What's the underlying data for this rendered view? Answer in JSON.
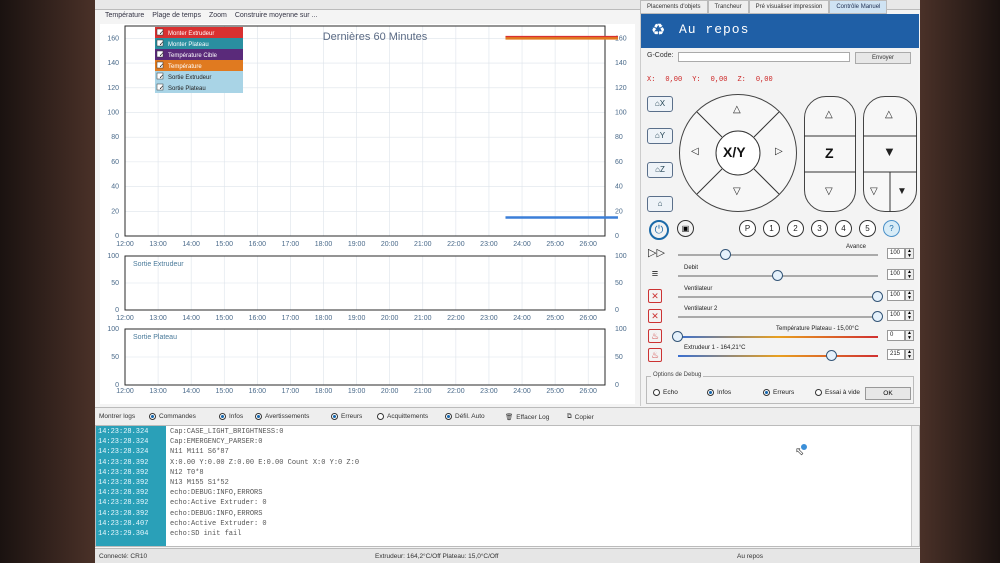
{
  "top_tabs": [
    "Placements d'objets",
    "Trancheur",
    "Pré visualiser impression",
    "Contrôle Manuel"
  ],
  "menu": [
    "Température",
    "Plage de temps",
    "Zoom",
    "Construire moyenne sur ..."
  ],
  "chart_data": [
    {
      "type": "line",
      "title": "Dernières 60 Minutes",
      "x_ticks": [
        "12:00",
        "13:00",
        "14:00",
        "15:00",
        "16:00",
        "17:00",
        "18:00",
        "19:00",
        "20:00",
        "21:00",
        "22:00",
        "23:00",
        "24:00",
        "25:00",
        "26:00"
      ],
      "y_ticks_left": [
        0,
        20,
        40,
        60,
        80,
        100,
        120,
        140,
        160
      ],
      "y_ticks_right": [
        0,
        20,
        40,
        60,
        80,
        100,
        120,
        140,
        160
      ],
      "ylim": [
        0,
        170
      ],
      "legend": [
        {
          "name": "Monter Extrudeur",
          "color": "#d93030",
          "checked": true
        },
        {
          "name": "Monter Plateau",
          "color": "#2a8fa0",
          "checked": true
        },
        {
          "name": "Température Cible",
          "color": "#5a2a7a",
          "checked": true
        },
        {
          "name": "Température",
          "color": "#e07a20",
          "checked": true
        },
        {
          "name": "Sortie Extrudeur",
          "color": "#6fb2d0",
          "checked": true
        },
        {
          "name": "Sortie Plateau",
          "color": "#6fb2d0",
          "checked": true
        }
      ],
      "series": [
        {
          "name": "Monter Extrudeur",
          "color": "#d93030",
          "x": [
            23.5,
            26.9
          ],
          "y": [
            161,
            161
          ]
        },
        {
          "name": "Température",
          "color": "#e07a20",
          "x": [
            23.5,
            26.9
          ],
          "y": [
            160,
            160
          ]
        },
        {
          "name": "Monter Plateau",
          "color": "#3b7fd8",
          "x": [
            23.5,
            26.9
          ],
          "y": [
            15,
            15
          ]
        }
      ]
    },
    {
      "type": "line",
      "title": "Sortie Extrudeur",
      "x_ticks": [
        "12:00",
        "13:00",
        "14:00",
        "15:00",
        "16:00",
        "17:00",
        "18:00",
        "19:00",
        "20:00",
        "21:00",
        "22:00",
        "23:00",
        "24:00",
        "25:00",
        "26:00"
      ],
      "y_ticks_left": [
        0,
        50,
        100
      ],
      "y_ticks_right": [
        0,
        50,
        100
      ],
      "ylim": [
        0,
        100
      ],
      "series": []
    },
    {
      "type": "line",
      "title": "Sortie Plateau",
      "x_ticks": [
        "12:00",
        "13:00",
        "14:00",
        "15:00",
        "16:00",
        "17:00",
        "18:00",
        "19:00",
        "20:00",
        "21:00",
        "22:00",
        "23:00",
        "24:00",
        "25:00",
        "26:00"
      ],
      "y_ticks_left": [
        0,
        50,
        100
      ],
      "y_ticks_right": [
        0,
        50,
        100
      ],
      "ylim": [
        0,
        100
      ],
      "series": []
    }
  ],
  "control": {
    "status": "Au repos",
    "gcode_label": "G-Code:",
    "send_label": "Envoyer",
    "coords": {
      "x_label": "X:",
      "x": "0,00",
      "y_label": "Y:",
      "y": "0,00",
      "z_label": "Z:",
      "z": "0,00"
    },
    "home_x": "X",
    "home_y": "Y",
    "home_z": "Z",
    "xy_label": "X/Y",
    "z_label": "Z",
    "icon_buttons": [
      "P",
      "1",
      "2",
      "3",
      "4",
      "5",
      "?"
    ],
    "sliders": [
      {
        "label": "Avance",
        "value": "100",
        "level": 0.24
      },
      {
        "label": "Debit",
        "value": "100",
        "level": 0.5
      },
      {
        "label": "Ventilateur",
        "value": "100",
        "level": 1.0
      },
      {
        "label": "Ventilateur 2",
        "value": "100",
        "level": 1.0
      },
      {
        "label": "Température Plateau - 15,00°C",
        "value": "0",
        "level": 0.0
      },
      {
        "label": "Extrudeur 1 - 164,21°C",
        "value": "215",
        "level": 0.77
      }
    ],
    "debug_title": "Options de Debug",
    "debug_options": [
      {
        "label": "Echo",
        "on": false
      },
      {
        "label": "Infos",
        "on": true
      },
      {
        "label": "Erreurs",
        "on": true
      },
      {
        "label": "Essai à vide",
        "on": false
      }
    ],
    "ok_label": "OK"
  },
  "log_toolbar": [
    {
      "label": "Montrer logs",
      "on": null
    },
    {
      "label": "Commandes",
      "on": true
    },
    {
      "label": "Infos",
      "on": true
    },
    {
      "label": "Avertissements",
      "on": true
    },
    {
      "label": "Erreurs",
      "on": true
    },
    {
      "label": "Acquittements",
      "on": false
    },
    {
      "label": "Défil. Auto",
      "on": true
    },
    {
      "label": "Effacer Log",
      "on": null
    },
    {
      "label": "Copier",
      "on": null
    }
  ],
  "log": [
    {
      "time": "14:23:28.324",
      "msg": "Cap:CASE_LIGHT_BRIGHTNESS:0"
    },
    {
      "time": "14:23:28.324",
      "msg": "Cap:EMERGENCY_PARSER:0"
    },
    {
      "time": "14:23:28.324",
      "msg": "N11 M111 S6*87"
    },
    {
      "time": "14:23:28.392",
      "msg": "X:0.00 Y:0.00 Z:0.00 E:0.00 Count X:0 Y:0 Z:0"
    },
    {
      "time": "14:23:28.392",
      "msg": "N12 T0*8"
    },
    {
      "time": "14:23:28.392",
      "msg": "N13 M155 S1*52"
    },
    {
      "time": "14:23:28.392",
      "msg": "echo:DEBUG:INFO,ERRORS"
    },
    {
      "time": "14:23:28.392",
      "msg": "echo:Active Extruder: 0"
    },
    {
      "time": "14:23:28.392",
      "msg": "echo:DEBUG:INFO,ERRORS"
    },
    {
      "time": "14:23:28.407",
      "msg": "echo:Active Extruder: 0"
    },
    {
      "time": "14:23:29.304",
      "msg": "echo:SD init fail"
    }
  ],
  "statusbar": {
    "connection": "Connecté: CR10",
    "temps": "Extrudeur: 164,2°C/Off Plateau: 15,0°C/Off",
    "state": "Au repos"
  }
}
